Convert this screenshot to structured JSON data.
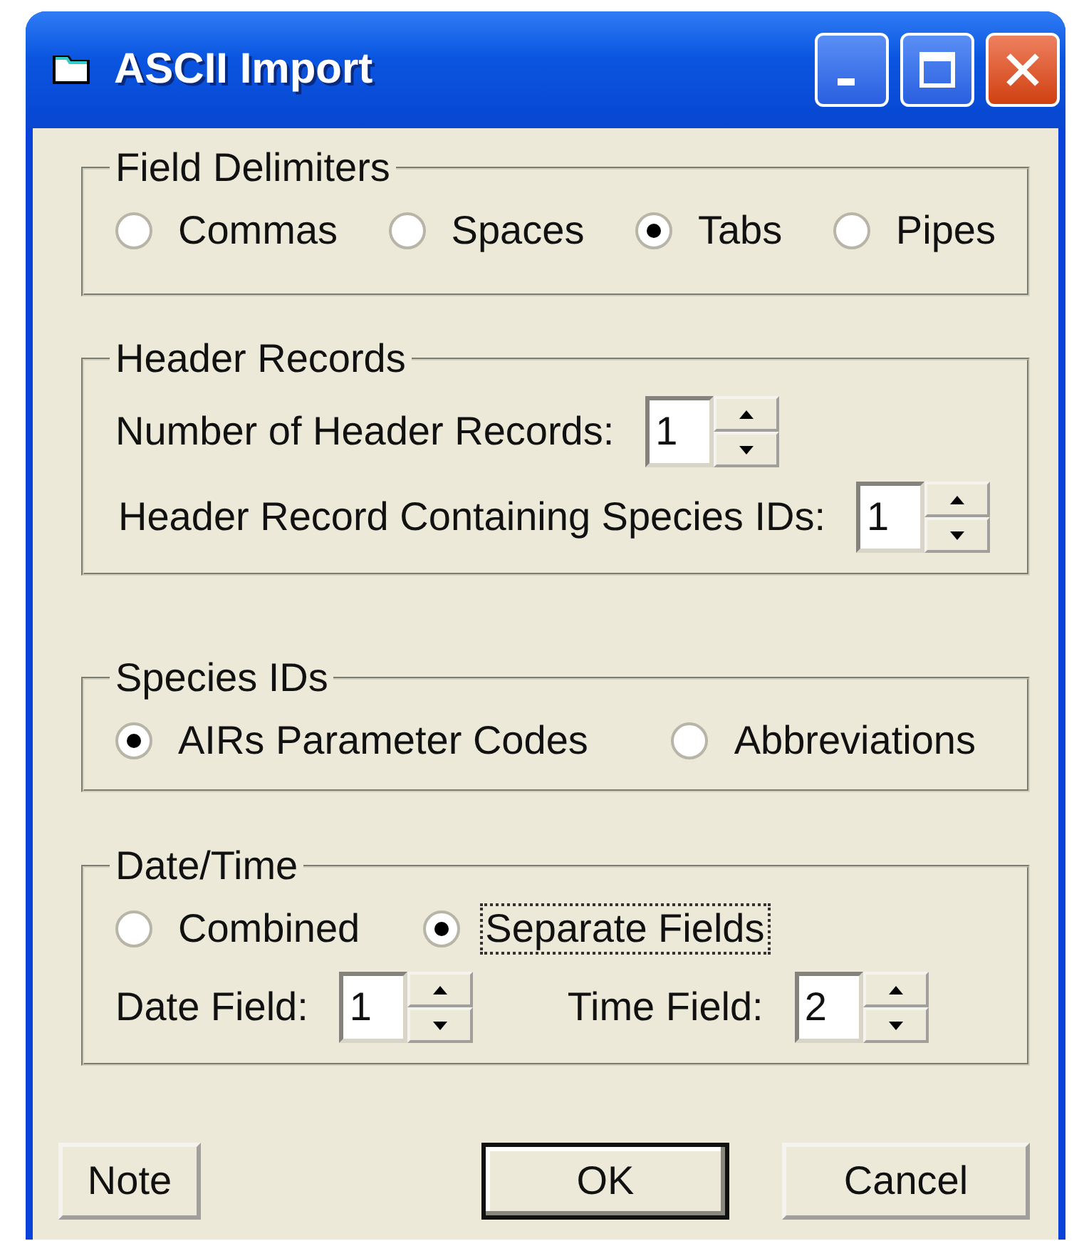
{
  "window": {
    "title": "ASCII Import"
  },
  "groups": [
    {
      "kind": "radios",
      "title": "Field Delimiters",
      "options": [
        {
          "label": "Commas",
          "selected": false,
          "focused": false
        },
        {
          "label": "Spaces",
          "selected": false,
          "focused": false
        },
        {
          "label": "Tabs",
          "selected": true,
          "focused": false
        },
        {
          "label": "Pipes",
          "selected": false,
          "focused": false
        }
      ]
    },
    {
      "kind": "spinner-rows",
      "title": "Header Records",
      "spinners": [
        {
          "label": "Number of Header Records:",
          "value": "1"
        },
        {
          "label": "Header Record Containing Species IDs:",
          "value": "1"
        }
      ]
    },
    {
      "kind": "radios",
      "title": "Species IDs",
      "options": [
        {
          "label": "AIRs Parameter Codes",
          "selected": true,
          "focused": false
        },
        {
          "label": "Abbreviations",
          "selected": false,
          "focused": false
        }
      ]
    },
    {
      "kind": "radios-and-spinners",
      "title": "Date/Time",
      "options": [
        {
          "label": "Combined",
          "selected": false,
          "focused": false
        },
        {
          "label": "Separate Fields",
          "selected": true,
          "focused": true
        }
      ],
      "spinners": [
        {
          "label": "Date Field:",
          "value": "1"
        },
        {
          "label": "Time Field:",
          "value": "2"
        }
      ]
    }
  ],
  "buttons": [
    {
      "label": "Note",
      "default": false
    },
    {
      "label": "OK",
      "default": true
    },
    {
      "label": "Cancel",
      "default": false
    }
  ]
}
